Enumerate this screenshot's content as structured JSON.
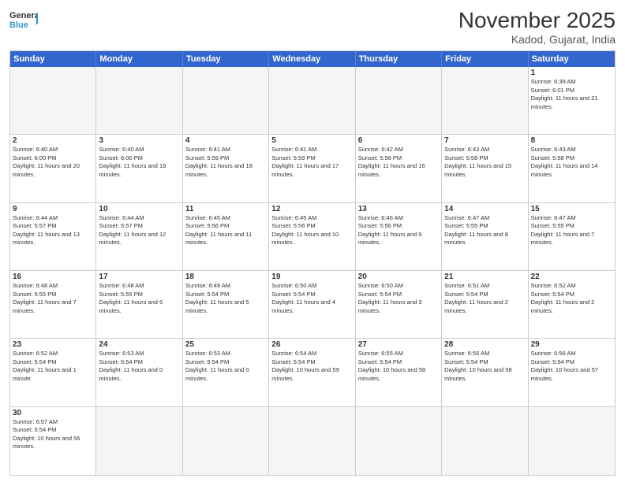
{
  "header": {
    "logo_general": "General",
    "logo_blue": "Blue",
    "month": "November 2025",
    "location": "Kadod, Gujarat, India"
  },
  "weekdays": [
    "Sunday",
    "Monday",
    "Tuesday",
    "Wednesday",
    "Thursday",
    "Friday",
    "Saturday"
  ],
  "rows": [
    [
      {
        "day": "",
        "empty": true,
        "info": ""
      },
      {
        "day": "",
        "empty": true,
        "info": ""
      },
      {
        "day": "",
        "empty": true,
        "info": ""
      },
      {
        "day": "",
        "empty": true,
        "info": ""
      },
      {
        "day": "",
        "empty": true,
        "info": ""
      },
      {
        "day": "",
        "empty": true,
        "info": ""
      },
      {
        "day": "1",
        "empty": false,
        "info": "Sunrise: 6:39 AM\nSunset: 6:01 PM\nDaylight: 11 hours and 21 minutes."
      }
    ],
    [
      {
        "day": "2",
        "empty": false,
        "info": "Sunrise: 6:40 AM\nSunset: 6:00 PM\nDaylight: 11 hours and 20 minutes."
      },
      {
        "day": "3",
        "empty": false,
        "info": "Sunrise: 6:40 AM\nSunset: 6:00 PM\nDaylight: 11 hours and 19 minutes."
      },
      {
        "day": "4",
        "empty": false,
        "info": "Sunrise: 6:41 AM\nSunset: 5:59 PM\nDaylight: 11 hours and 18 minutes."
      },
      {
        "day": "5",
        "empty": false,
        "info": "Sunrise: 6:41 AM\nSunset: 5:59 PM\nDaylight: 11 hours and 17 minutes."
      },
      {
        "day": "6",
        "empty": false,
        "info": "Sunrise: 6:42 AM\nSunset: 5:58 PM\nDaylight: 11 hours and 16 minutes."
      },
      {
        "day": "7",
        "empty": false,
        "info": "Sunrise: 6:43 AM\nSunset: 5:58 PM\nDaylight: 11 hours and 15 minutes."
      },
      {
        "day": "8",
        "empty": false,
        "info": "Sunrise: 6:43 AM\nSunset: 5:58 PM\nDaylight: 11 hours and 14 minutes."
      }
    ],
    [
      {
        "day": "9",
        "empty": false,
        "info": "Sunrise: 6:44 AM\nSunset: 5:57 PM\nDaylight: 11 hours and 13 minutes."
      },
      {
        "day": "10",
        "empty": false,
        "info": "Sunrise: 6:44 AM\nSunset: 5:57 PM\nDaylight: 11 hours and 12 minutes."
      },
      {
        "day": "11",
        "empty": false,
        "info": "Sunrise: 6:45 AM\nSunset: 5:56 PM\nDaylight: 11 hours and 11 minutes."
      },
      {
        "day": "12",
        "empty": false,
        "info": "Sunrise: 6:45 AM\nSunset: 5:56 PM\nDaylight: 11 hours and 10 minutes."
      },
      {
        "day": "13",
        "empty": false,
        "info": "Sunrise: 6:46 AM\nSunset: 5:56 PM\nDaylight: 11 hours and 9 minutes."
      },
      {
        "day": "14",
        "empty": false,
        "info": "Sunrise: 6:47 AM\nSunset: 5:55 PM\nDaylight: 11 hours and 8 minutes."
      },
      {
        "day": "15",
        "empty": false,
        "info": "Sunrise: 6:47 AM\nSunset: 5:55 PM\nDaylight: 11 hours and 7 minutes."
      }
    ],
    [
      {
        "day": "16",
        "empty": false,
        "info": "Sunrise: 6:48 AM\nSunset: 5:55 PM\nDaylight: 11 hours and 7 minutes."
      },
      {
        "day": "17",
        "empty": false,
        "info": "Sunrise: 6:48 AM\nSunset: 5:55 PM\nDaylight: 11 hours and 6 minutes."
      },
      {
        "day": "18",
        "empty": false,
        "info": "Sunrise: 6:49 AM\nSunset: 5:54 PM\nDaylight: 11 hours and 5 minutes."
      },
      {
        "day": "19",
        "empty": false,
        "info": "Sunrise: 6:50 AM\nSunset: 5:54 PM\nDaylight: 11 hours and 4 minutes."
      },
      {
        "day": "20",
        "empty": false,
        "info": "Sunrise: 6:50 AM\nSunset: 5:54 PM\nDaylight: 11 hours and 3 minutes."
      },
      {
        "day": "21",
        "empty": false,
        "info": "Sunrise: 6:51 AM\nSunset: 5:54 PM\nDaylight: 11 hours and 2 minutes."
      },
      {
        "day": "22",
        "empty": false,
        "info": "Sunrise: 6:52 AM\nSunset: 5:54 PM\nDaylight: 11 hours and 2 minutes."
      }
    ],
    [
      {
        "day": "23",
        "empty": false,
        "info": "Sunrise: 6:52 AM\nSunset: 5:54 PM\nDaylight: 11 hours and 1 minute."
      },
      {
        "day": "24",
        "empty": false,
        "info": "Sunrise: 6:53 AM\nSunset: 5:54 PM\nDaylight: 11 hours and 0 minutes."
      },
      {
        "day": "25",
        "empty": false,
        "info": "Sunrise: 6:53 AM\nSunset: 5:54 PM\nDaylight: 11 hours and 0 minutes."
      },
      {
        "day": "26",
        "empty": false,
        "info": "Sunrise: 6:54 AM\nSunset: 5:54 PM\nDaylight: 10 hours and 59 minutes."
      },
      {
        "day": "27",
        "empty": false,
        "info": "Sunrise: 6:55 AM\nSunset: 5:54 PM\nDaylight: 10 hours and 58 minutes."
      },
      {
        "day": "28",
        "empty": false,
        "info": "Sunrise: 6:55 AM\nSunset: 5:54 PM\nDaylight: 10 hours and 58 minutes."
      },
      {
        "day": "29",
        "empty": false,
        "info": "Sunrise: 6:56 AM\nSunset: 5:54 PM\nDaylight: 10 hours and 57 minutes."
      }
    ],
    [
      {
        "day": "30",
        "empty": false,
        "info": "Sunrise: 6:57 AM\nSunset: 5:54 PM\nDaylight: 10 hours and 56 minutes."
      },
      {
        "day": "",
        "empty": true,
        "info": ""
      },
      {
        "day": "",
        "empty": true,
        "info": ""
      },
      {
        "day": "",
        "empty": true,
        "info": ""
      },
      {
        "day": "",
        "empty": true,
        "info": ""
      },
      {
        "day": "",
        "empty": true,
        "info": ""
      },
      {
        "day": "",
        "empty": true,
        "info": ""
      }
    ]
  ]
}
